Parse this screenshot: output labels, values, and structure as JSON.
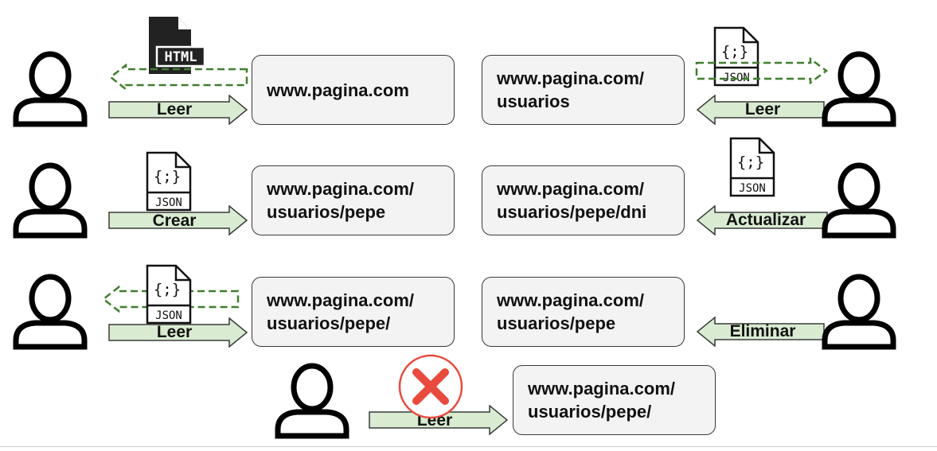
{
  "colors": {
    "arrow_fill": "#d9ecd2",
    "arrow_stroke": "#3a3a3a",
    "dashed_green": "#3f7f2e",
    "box_fill": "#f3f3f3",
    "error_red": "#e84a3d"
  },
  "urls": {
    "r1_left": [
      "www.pagina.com"
    ],
    "r1_right": [
      "www.pagina.com/",
      "usuarios"
    ],
    "r2_left": [
      "www.pagina.com/",
      "usuarios/pepe"
    ],
    "r2_right": [
      "www.pagina.com/",
      "usuarios/pepe/dni"
    ],
    "r3_left": [
      "www.pagina.com/",
      "usuarios/pepe/"
    ],
    "r3_right": [
      "www.pagina.com/",
      "usuarios/pepe"
    ],
    "r4": [
      "www.pagina.com/",
      "usuarios/pepe/"
    ]
  },
  "labels": {
    "r1_left": "Leer",
    "r1_right": "Leer",
    "r2_left": "Crear",
    "r2_right": "Actualizar",
    "r3_left": "Leer",
    "r3_right": "Eliminar",
    "r4": "Leer"
  },
  "docs": {
    "html": "HTML",
    "json": "JSON",
    "braces": "{;}"
  },
  "icons": {
    "user": "user-outline-icon",
    "html_file": "html-file-icon",
    "json_file": "json-file-icon",
    "error": "error-x-icon"
  }
}
